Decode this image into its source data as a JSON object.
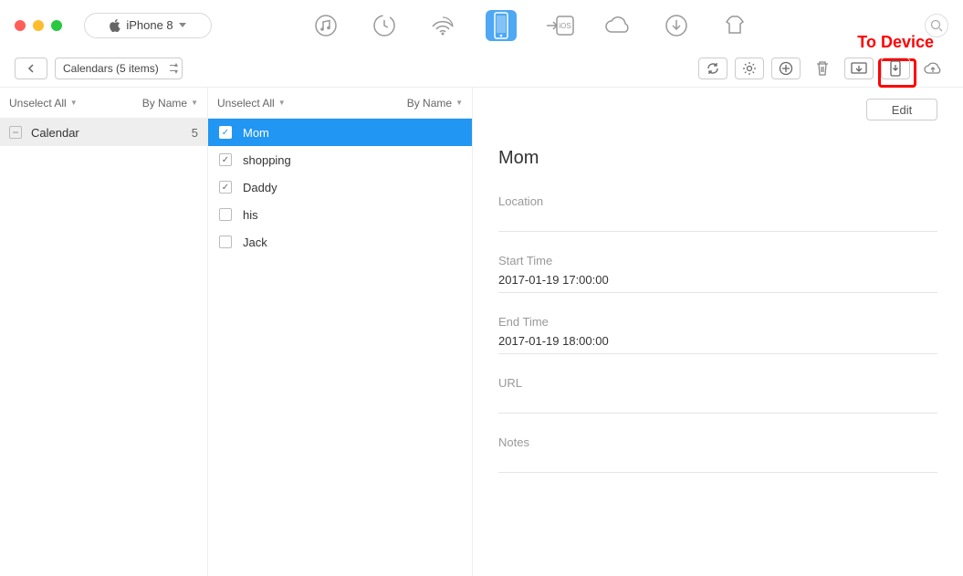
{
  "header": {
    "device_label": "iPhone 8",
    "annotation": "To Device"
  },
  "crumb": {
    "label": "Calendars (5 items)"
  },
  "col1": {
    "unselect_label": "Unselect All",
    "sort_label": "By Name",
    "items": [
      {
        "name": "Calendar",
        "count": "5"
      }
    ]
  },
  "col2": {
    "unselect_label": "Unselect All",
    "sort_label": "By Name",
    "events": [
      {
        "name": "Mom",
        "checked": true,
        "selected": true
      },
      {
        "name": "shopping",
        "checked": true,
        "selected": false
      },
      {
        "name": "Daddy",
        "checked": true,
        "selected": false
      },
      {
        "name": "his",
        "checked": false,
        "selected": false
      },
      {
        "name": "Jack",
        "checked": false,
        "selected": false
      }
    ]
  },
  "detail": {
    "edit_label": "Edit",
    "title": "Mom",
    "fields": {
      "location_label": "Location",
      "location_value": "",
      "start_label": "Start Time",
      "start_value": "2017-01-19 17:00:00",
      "end_label": "End Time",
      "end_value": "2017-01-19 18:00:00",
      "url_label": "URL",
      "url_value": "",
      "notes_label": "Notes",
      "notes_value": ""
    }
  }
}
